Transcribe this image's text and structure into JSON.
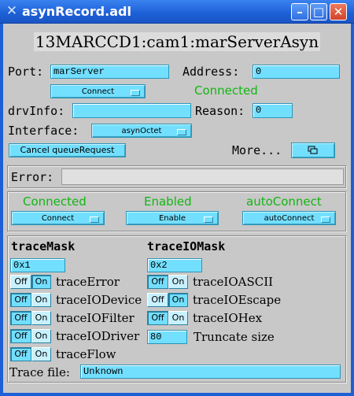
{
  "window": {
    "title": "asynRecord.adl",
    "app_icon": "x-icon"
  },
  "header": {
    "record_name": "13MARCCD1:cam1:marServerAsyn"
  },
  "port": {
    "label": "Port:",
    "value": "marServer"
  },
  "address": {
    "label": "Address:",
    "value": "0"
  },
  "connect_menu": {
    "value": "Connect"
  },
  "connection_status": "Connected",
  "drvinfo": {
    "label": "drvInfo:",
    "value": ""
  },
  "reason": {
    "label": "Reason:",
    "value": "0"
  },
  "interface": {
    "label": "Interface:",
    "value": "asynOctet"
  },
  "cancel_queue_button": "Cancel queueRequest",
  "more": {
    "label": "More...",
    "icon": "related-display-icon"
  },
  "error": {
    "label": "Error:",
    "value": ""
  },
  "status": {
    "items": [
      {
        "status": "Connected",
        "menu": "Connect"
      },
      {
        "status": "Enabled",
        "menu": "Enable"
      },
      {
        "status": "autoConnect",
        "menu": "autoConnect"
      }
    ]
  },
  "trace": {
    "mask_title": "traceMask",
    "mask_value": "0x1",
    "io_mask_title": "traceIOMask",
    "io_mask_value": "0x2",
    "off_label": "Off",
    "on_label": "On",
    "left": [
      {
        "label": "traceError",
        "state": "on"
      },
      {
        "label": "traceIODevice",
        "state": "off"
      },
      {
        "label": "traceIOFilter",
        "state": "off"
      },
      {
        "label": "traceIODriver",
        "state": "off"
      },
      {
        "label": "traceFlow",
        "state": "off"
      }
    ],
    "right": [
      {
        "label": "traceIOASCII",
        "state": "off"
      },
      {
        "label": "traceIOEscape",
        "state": "on"
      },
      {
        "label": "traceIOHex",
        "state": "off"
      }
    ],
    "truncate": {
      "value": "80",
      "label": "Truncate size"
    },
    "file": {
      "label": "Trace file:",
      "value": "Unknown"
    }
  },
  "colors": {
    "field": "#73dfff",
    "status_green": "#12b612",
    "titlebar": "#1d5fd6",
    "background": "#c8c8c8"
  }
}
